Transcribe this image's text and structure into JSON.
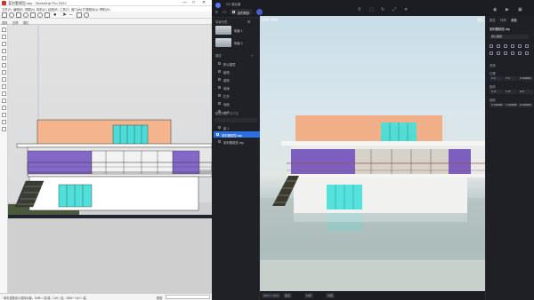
{
  "left_app": {
    "title": "某别墅模型.skp - SketchUp Pro 2022",
    "window_controls": [
      "—",
      "□",
      "✕"
    ],
    "menu": [
      "文件(F)",
      "编辑(E)",
      "视图(V)",
      "相机(C)",
      "绘图(R)",
      "工具(T)",
      "窗口(W)",
      "扩展程序(x)",
      "帮助(H)"
    ],
    "toolbar2": [
      "选择",
      "拉伸",
      "推拉"
    ],
    "status": "单击或拖动以选择对象。Shift = 加/减，Ctrl = 加，Shift + Ctrl = 减。",
    "measurements_label": "数值"
  },
  "right_app": {
    "title": "D5 渲染器",
    "mode_label": "实时同步",
    "scenes_header": "场景列表",
    "scenes": [
      "场景 1",
      "场景 2"
    ],
    "layers_header": "图层",
    "layers": [
      "默认图层",
      "植物",
      "建筑",
      "玻璃",
      "栏杆",
      "地面",
      "水体"
    ],
    "model_header": "模型列表",
    "model_tab2": "素材库",
    "model_items": [
      "组 1",
      "某别墅模型.skp",
      "某别墅模型.skp"
    ],
    "bottom_chips": [
      "3840 × 2160",
      "图层",
      "材质",
      "视图"
    ],
    "props": {
      "tabs": [
        "属性",
        "材质",
        "参数"
      ],
      "model_name": "某别墅模型.skp",
      "sub_label": "默认图层",
      "section_transform": "变换",
      "position_label": "位置",
      "pos": [
        "X 0",
        "Y 0",
        "Z 100000"
      ],
      "rotation_label": "旋转",
      "rot": [
        "X 0°",
        "Y 0°",
        "Z 0°"
      ],
      "scale_label": "缩放",
      "scale": [
        "X 100000",
        "Y 100000",
        "Z 100000"
      ]
    }
  },
  "colors": {
    "accent": "#2b6fe0",
    "dark_panel": "#1c1d22",
    "sketch_bg": "#efefef"
  }
}
